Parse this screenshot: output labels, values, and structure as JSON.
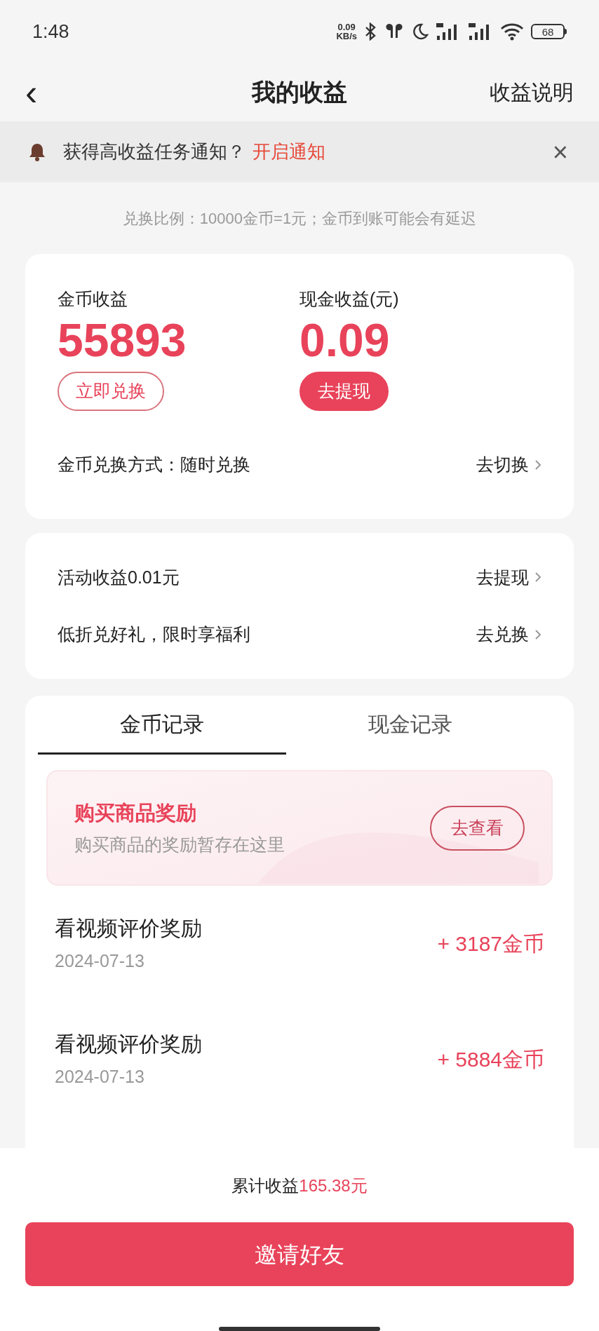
{
  "status_bar": {
    "time": "1:48",
    "net_speed": "0.09",
    "net_unit": "KB/s",
    "battery": "68"
  },
  "header": {
    "back": "‹",
    "title": "我的收益",
    "action": "收益说明"
  },
  "notice": {
    "text": "获得高收益任务通知？",
    "link": "开启通知",
    "close": "×"
  },
  "ratio_note": "兑换比例：10000金币=1元；金币到账可能会有延迟",
  "balances": [
    {
      "label": "金币收益",
      "value": "55893",
      "button": "立即兑换",
      "kind": "outline"
    },
    {
      "label": "现金收益(元)",
      "value": "0.09",
      "button": "去提现",
      "kind": "filled"
    }
  ],
  "exchange_row": {
    "label": "金币兑换方式：随时兑换",
    "action": "去切换"
  },
  "activity_rows": [
    {
      "label": "活动收益0.01元",
      "action": "去提现"
    },
    {
      "label": "低折兑好礼，限时享福利",
      "action": "去兑换"
    }
  ],
  "tabs": [
    {
      "label": "金币记录",
      "selected": true
    },
    {
      "label": "现金记录",
      "selected": false
    }
  ],
  "promo": {
    "title": "购买商品奖励",
    "subtitle": "购买商品的奖励暂存在这里",
    "button": "去查看"
  },
  "records": [
    {
      "title": "看视频评价奖励",
      "date": "2024-07-13",
      "amount": "+ 3187金币"
    },
    {
      "title": "看视频评价奖励",
      "date": "2024-07-13",
      "amount": "+ 5884金币"
    }
  ],
  "footer": {
    "total_label": "累计收益",
    "total_value": "165.38元",
    "button": "邀请好友"
  }
}
